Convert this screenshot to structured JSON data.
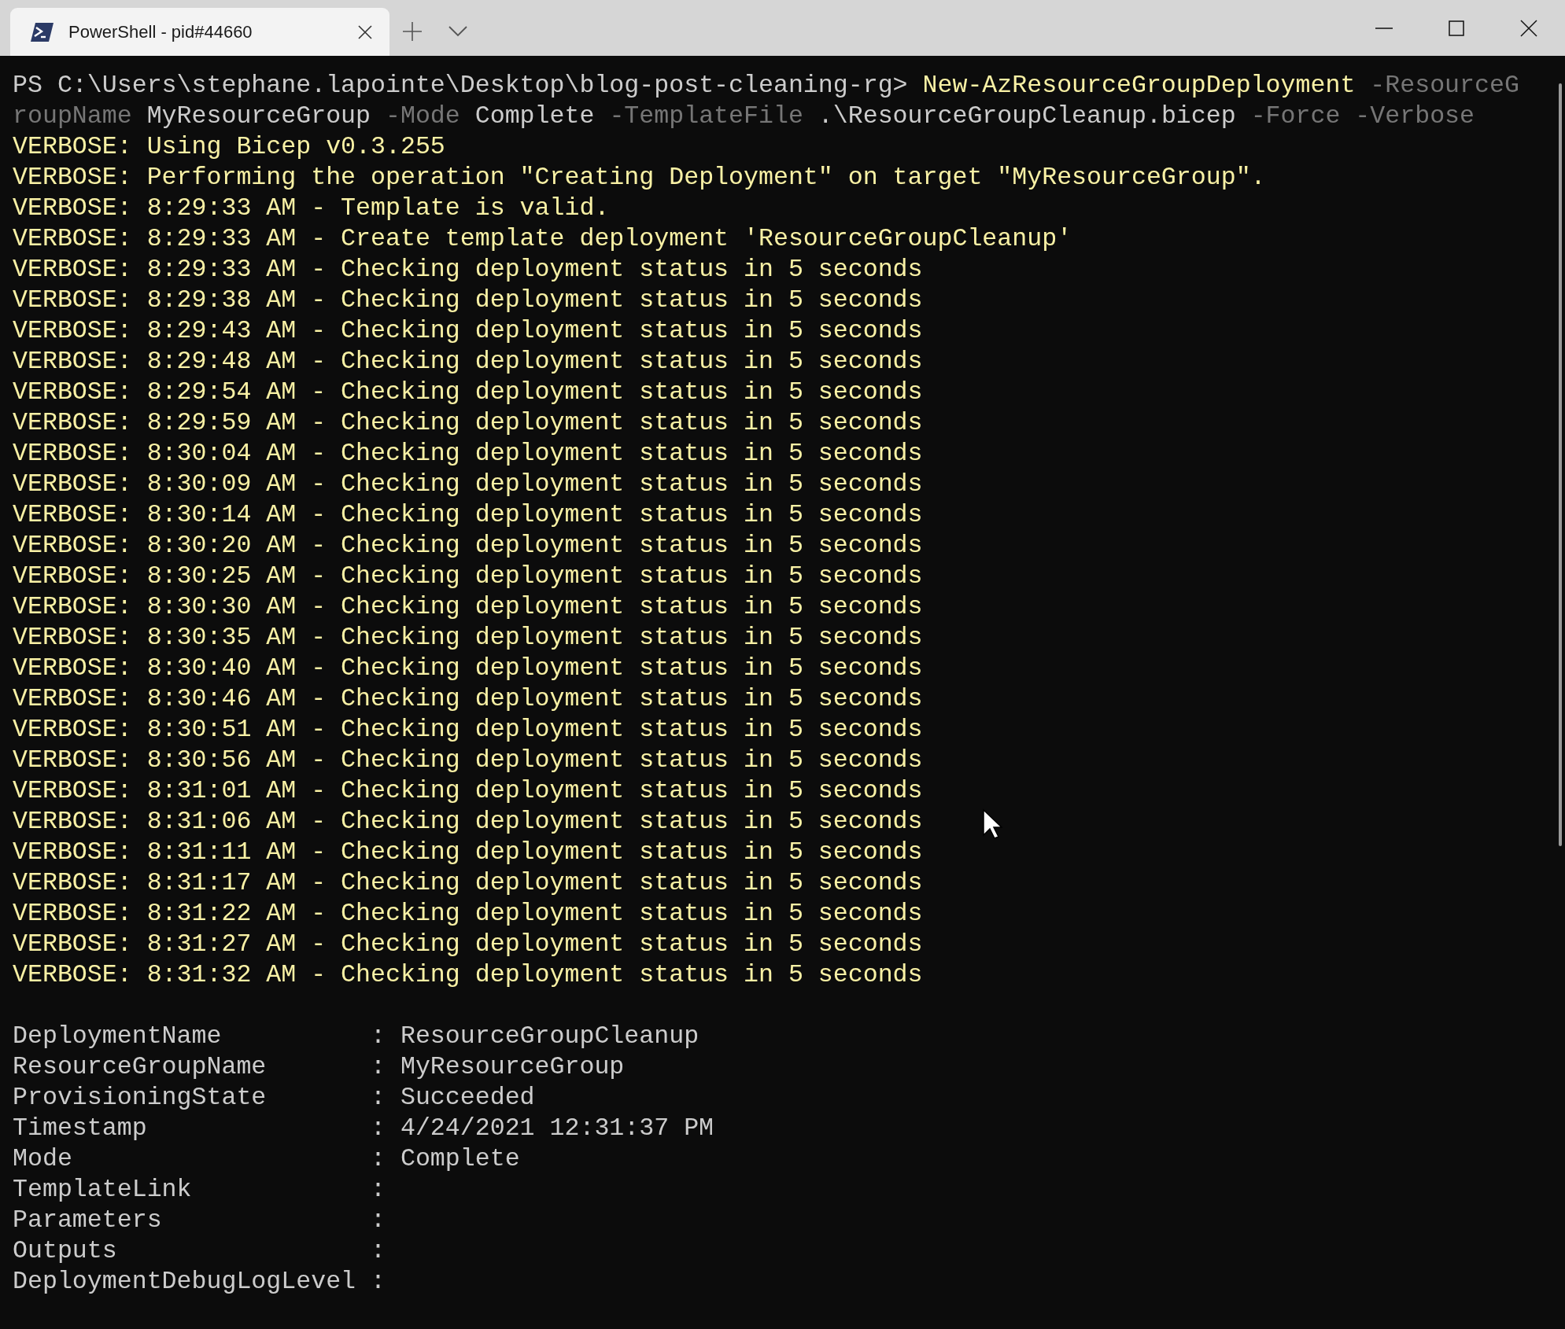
{
  "tabs": [
    {
      "title": "PowerShell - pid#44660",
      "selected": true
    }
  ],
  "command_lines": [
    [
      {
        "kind": "prompt",
        "text": "PS C:\\Users\\stephane.lapointe\\Desktop\\blog-post-cleaning-rg>"
      },
      {
        "kind": "cmdlet",
        "text": "New-AzResourceGroupDeployment"
      },
      {
        "kind": "param",
        "text": "-ResourceG"
      }
    ],
    [
      {
        "kind": "param",
        "text": "roupName"
      },
      {
        "kind": "arg",
        "text": "MyResourceGroup"
      },
      {
        "kind": "param",
        "text": "-Mode"
      },
      {
        "kind": "arg",
        "text": "Complete"
      },
      {
        "kind": "param",
        "text": "-TemplateFile"
      },
      {
        "kind": "arg",
        "text": ".\\ResourceGroupCleanup.bicep"
      },
      {
        "kind": "param",
        "text": "-Force"
      },
      {
        "kind": "param",
        "text": "-Verbose"
      }
    ]
  ],
  "verbose_lines": [
    "VERBOSE: Using Bicep v0.3.255",
    "VERBOSE: Performing the operation \"Creating Deployment\" on target \"MyResourceGroup\".",
    "VERBOSE: 8:29:33 AM - Template is valid.",
    "VERBOSE: 8:29:33 AM - Create template deployment 'ResourceGroupCleanup'",
    "VERBOSE: 8:29:33 AM - Checking deployment status in 5 seconds",
    "VERBOSE: 8:29:38 AM - Checking deployment status in 5 seconds",
    "VERBOSE: 8:29:43 AM - Checking deployment status in 5 seconds",
    "VERBOSE: 8:29:48 AM - Checking deployment status in 5 seconds",
    "VERBOSE: 8:29:54 AM - Checking deployment status in 5 seconds",
    "VERBOSE: 8:29:59 AM - Checking deployment status in 5 seconds",
    "VERBOSE: 8:30:04 AM - Checking deployment status in 5 seconds",
    "VERBOSE: 8:30:09 AM - Checking deployment status in 5 seconds",
    "VERBOSE: 8:30:14 AM - Checking deployment status in 5 seconds",
    "VERBOSE: 8:30:20 AM - Checking deployment status in 5 seconds",
    "VERBOSE: 8:30:25 AM - Checking deployment status in 5 seconds",
    "VERBOSE: 8:30:30 AM - Checking deployment status in 5 seconds",
    "VERBOSE: 8:30:35 AM - Checking deployment status in 5 seconds",
    "VERBOSE: 8:30:40 AM - Checking deployment status in 5 seconds",
    "VERBOSE: 8:30:46 AM - Checking deployment status in 5 seconds",
    "VERBOSE: 8:30:51 AM - Checking deployment status in 5 seconds",
    "VERBOSE: 8:30:56 AM - Checking deployment status in 5 seconds",
    "VERBOSE: 8:31:01 AM - Checking deployment status in 5 seconds",
    "VERBOSE: 8:31:06 AM - Checking deployment status in 5 seconds",
    "VERBOSE: 8:31:11 AM - Checking deployment status in 5 seconds",
    "VERBOSE: 8:31:17 AM - Checking deployment status in 5 seconds",
    "VERBOSE: 8:31:22 AM - Checking deployment status in 5 seconds",
    "VERBOSE: 8:31:27 AM - Checking deployment status in 5 seconds",
    "VERBOSE: 8:31:32 AM - Checking deployment status in 5 seconds"
  ],
  "output": [
    {
      "name": "DeploymentName",
      "separator": ":",
      "value": "ResourceGroupCleanup"
    },
    {
      "name": "ResourceGroupName",
      "separator": ":",
      "value": "MyResourceGroup"
    },
    {
      "name": "ProvisioningState",
      "separator": ":",
      "value": "Succeeded"
    },
    {
      "name": "Timestamp",
      "separator": ":",
      "value": "4/24/2021 12:31:37 PM"
    },
    {
      "name": "Mode",
      "separator": ":",
      "value": "Complete"
    },
    {
      "name": "TemplateLink",
      "separator": ":"
    },
    {
      "name": "Parameters",
      "separator": ":"
    },
    {
      "name": "Outputs",
      "separator": ":"
    },
    {
      "name": "DeploymentDebugLogLevel",
      "separator": ":"
    }
  ]
}
